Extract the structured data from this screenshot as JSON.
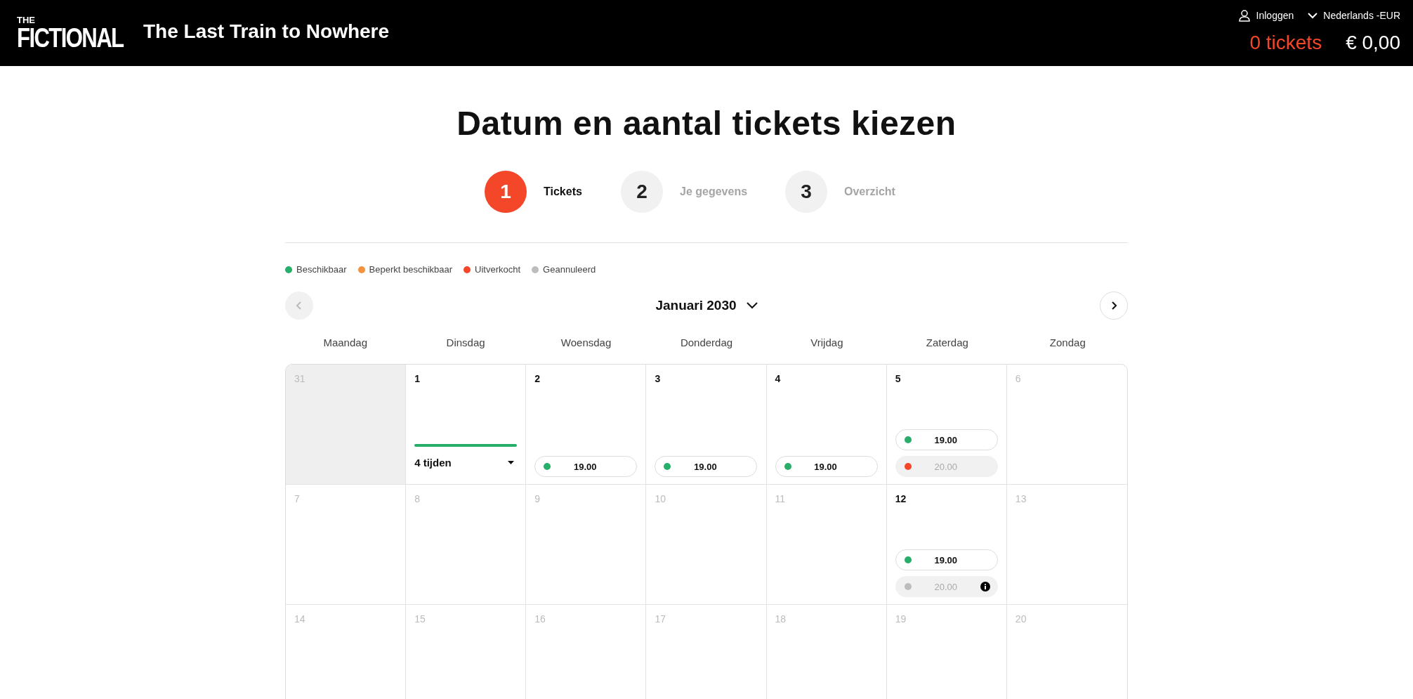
{
  "header": {
    "logo": {
      "top": "THE",
      "main": "FICTIONAL"
    },
    "event_title": "The Last Train to Nowhere",
    "login": "Inloggen",
    "language": "Nederlands -EUR",
    "tickets": "0 tickets",
    "total": "€ 0,00"
  },
  "page_title": "Datum en aantal tickets kiezen",
  "steps": [
    {
      "number": "1",
      "label": "Tickets",
      "selected": true
    },
    {
      "number": "2",
      "label": "Je gegevens",
      "selected": false
    },
    {
      "number": "3",
      "label": "Overzicht",
      "selected": false
    }
  ],
  "legend": [
    {
      "label": "Beschikbaar",
      "color": "#27ae6a"
    },
    {
      "label": "Beperkt beschikbaar",
      "color": "#f5923e"
    },
    {
      "label": "Uitverkocht",
      "color": "#f4472a"
    },
    {
      "label": "Geannuleerd",
      "color": "#bdbdbd"
    }
  ],
  "calendar": {
    "month": "Januari 2030",
    "prev_disabled": true,
    "next_disabled": false,
    "weekdays": [
      "Maandag",
      "Dinsdag",
      "Woensdag",
      "Donderdag",
      "Vrijdag",
      "Zaterdag",
      "Zondag"
    ],
    "weeks": [
      [
        {
          "date": "31",
          "active": false,
          "past": true
        },
        {
          "date": "1",
          "active": true,
          "past": false,
          "summary": {
            "label": "4 tijden",
            "color": "#27ae6a"
          }
        },
        {
          "date": "2",
          "active": true,
          "past": false,
          "sessions": [
            {
              "time": "19.00",
              "color": "#27ae6a",
              "available": true,
              "info": false
            }
          ]
        },
        {
          "date": "3",
          "active": true,
          "past": false,
          "sessions": [
            {
              "time": "19.00",
              "color": "#27ae6a",
              "available": true,
              "info": false
            }
          ]
        },
        {
          "date": "4",
          "active": true,
          "past": false,
          "sessions": [
            {
              "time": "19.00",
              "color": "#27ae6a",
              "available": true,
              "info": false
            }
          ]
        },
        {
          "date": "5",
          "active": true,
          "past": false,
          "sessions": [
            {
              "time": "19.00",
              "color": "#27ae6a",
              "available": true,
              "info": false
            },
            {
              "time": "20.00",
              "color": "#f4472a",
              "available": false,
              "info": false
            }
          ]
        },
        {
          "date": "6",
          "active": false,
          "past": false
        }
      ],
      [
        {
          "date": "7",
          "active": false,
          "past": false
        },
        {
          "date": "8",
          "active": false,
          "past": false
        },
        {
          "date": "9",
          "active": false,
          "past": false
        },
        {
          "date": "10",
          "active": false,
          "past": false
        },
        {
          "date": "11",
          "active": false,
          "past": false
        },
        {
          "date": "12",
          "active": true,
          "past": false,
          "sessions": [
            {
              "time": "19.00",
              "color": "#27ae6a",
              "available": true,
              "info": false
            },
            {
              "time": "20.00",
              "color": "#bdbdbd",
              "available": false,
              "info": true
            }
          ]
        },
        {
          "date": "13",
          "active": false,
          "past": false
        }
      ],
      [
        {
          "date": "14",
          "active": false,
          "past": false
        },
        {
          "date": "15",
          "active": false,
          "past": false
        },
        {
          "date": "16",
          "active": false,
          "past": false
        },
        {
          "date": "17",
          "active": false,
          "past": false
        },
        {
          "date": "18",
          "active": false,
          "past": false
        },
        {
          "date": "19",
          "active": false,
          "past": false
        },
        {
          "date": "20",
          "active": false,
          "past": false
        }
      ]
    ]
  }
}
